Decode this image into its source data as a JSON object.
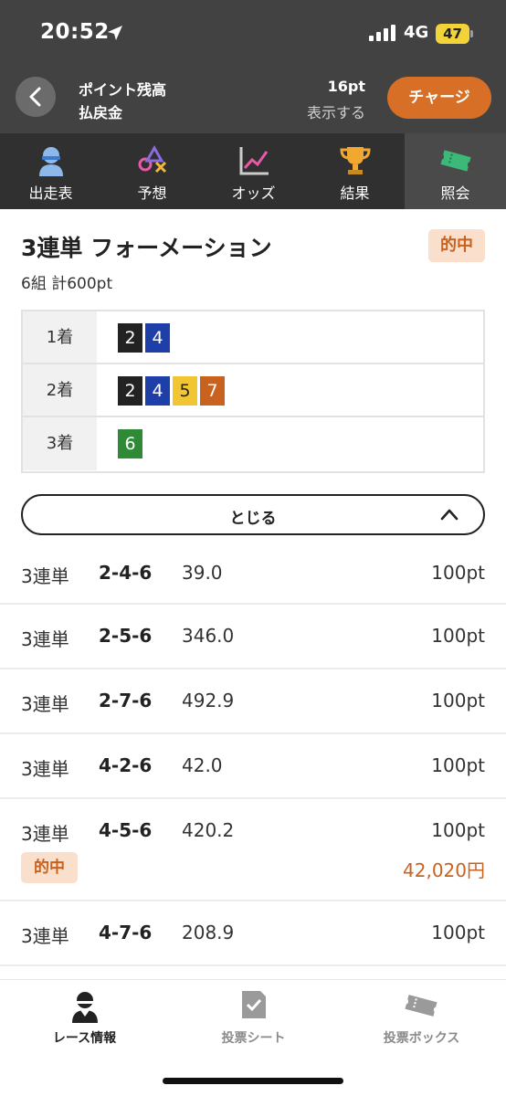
{
  "status_bar": {
    "time": "20:52",
    "network": "4G",
    "battery": "47"
  },
  "header": {
    "points_label": "ポイント残高",
    "refund_label": "払戻金",
    "points_value": "16pt",
    "show_link": "表示する",
    "charge_button": "チャージ"
  },
  "tabs": [
    {
      "label": "出走表",
      "icon": "jockey-icon"
    },
    {
      "label": "予想",
      "icon": "shapes-icon"
    },
    {
      "label": "オッズ",
      "icon": "chart-icon"
    },
    {
      "label": "結果",
      "icon": "trophy-icon"
    },
    {
      "label": "照会",
      "icon": "ticket-icon",
      "active": true
    }
  ],
  "bet": {
    "title": "3連単 フォーメーション",
    "hit_badge": "的中",
    "summary": "6組 計600pt",
    "formation": [
      {
        "place": "1着",
        "boats": [
          "2",
          "4"
        ]
      },
      {
        "place": "2着",
        "boats": [
          "2",
          "4",
          "5",
          "7"
        ]
      },
      {
        "place": "3着",
        "boats": [
          "6"
        ]
      }
    ],
    "boat_colors": {
      "2": {
        "bg": "#222222",
        "fg": "#ffffff"
      },
      "4": {
        "bg": "#1f3fa8",
        "fg": "#ffffff"
      },
      "5": {
        "bg": "#f2c633",
        "fg": "#222222"
      },
      "6": {
        "bg": "#2f8a36",
        "fg": "#ffffff"
      },
      "7": {
        "bg": "#c9621e",
        "fg": "#ffffff"
      }
    },
    "close_button": "とじる"
  },
  "rows": [
    {
      "type": "3連単",
      "combo": "2-4-6",
      "odds": "39.0",
      "amount": "100pt"
    },
    {
      "type": "3連単",
      "combo": "2-5-6",
      "odds": "346.0",
      "amount": "100pt"
    },
    {
      "type": "3連単",
      "combo": "2-7-6",
      "odds": "492.9",
      "amount": "100pt"
    },
    {
      "type": "3連単",
      "combo": "4-2-6",
      "odds": "42.0",
      "amount": "100pt"
    },
    {
      "type": "3連単",
      "combo": "4-5-6",
      "odds": "420.2",
      "amount": "100pt",
      "hit": "的中",
      "payout": "42,020円"
    },
    {
      "type": "3連単",
      "combo": "4-7-6",
      "odds": "208.9",
      "amount": "100pt"
    }
  ],
  "bottom_nav": [
    {
      "label": "レース情報",
      "icon": "jockey-icon",
      "active": true
    },
    {
      "label": "投票シート",
      "icon": "sheet-check-icon"
    },
    {
      "label": "投票ボックス",
      "icon": "ticket-icon"
    }
  ],
  "colors": {
    "accent": "#d86f27",
    "header_bg": "#424242",
    "tab_bg": "#303030",
    "hit_text": "#c9621e",
    "hit_bg": "#f9dfcc"
  }
}
